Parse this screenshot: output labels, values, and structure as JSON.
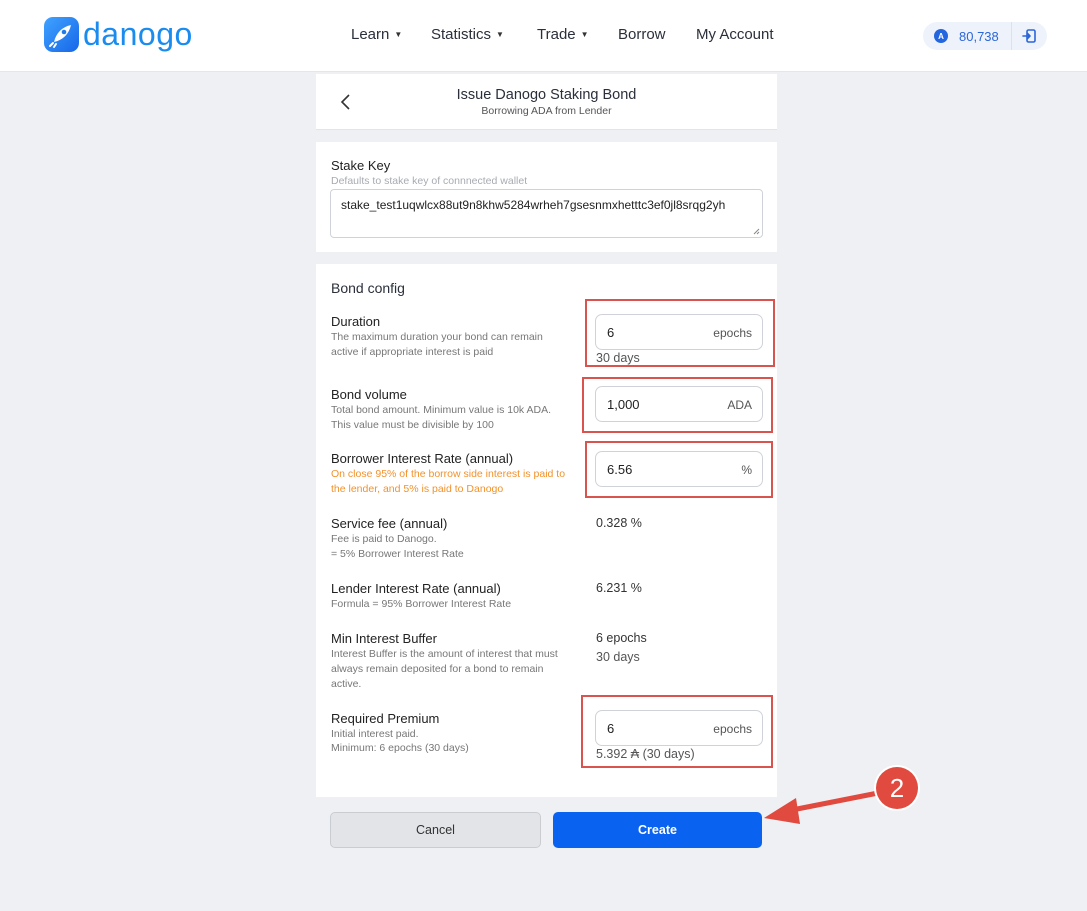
{
  "header": {
    "logo_text": "danogo",
    "nav": [
      {
        "label": "Learn",
        "has_caret": true
      },
      {
        "label": "Statistics",
        "has_caret": true
      },
      {
        "label": "Trade",
        "has_caret": true
      },
      {
        "label": "Borrow",
        "has_caret": false
      },
      {
        "label": "My Account",
        "has_caret": false
      }
    ],
    "balance": "80,738",
    "balance_badge": "A"
  },
  "page": {
    "title": "Issue Danogo Staking Bond",
    "subtitle": "Borrowing ADA from Lender"
  },
  "stake": {
    "label": "Stake Key",
    "hint": "Defaults to stake key of connnected wallet",
    "value": "stake_test1uqwlcx88ut9n8khw5284wrheh7gsesnmxhetttc3ef0jl8srqg2yh"
  },
  "config": {
    "section_title": "Bond config",
    "duration": {
      "label": "Duration",
      "hint": "The maximum duration your bond can remain active if appropriate interest is paid",
      "value": "6",
      "unit": "epochs",
      "below": "30 days"
    },
    "volume": {
      "label": "Bond volume",
      "hint1": "Total bond amount. Minimum value is 10k ADA.",
      "hint2": "This value must be divisible by 100",
      "value": "1,000",
      "unit": "ADA"
    },
    "borrower_rate": {
      "label": "Borrower Interest Rate (annual)",
      "hint": "On close 95% of the borrow side interest is paid to the lender, and 5% is paid to Danogo",
      "value": "6.56",
      "unit": "%"
    },
    "service_fee": {
      "label": "Service fee (annual)",
      "hint1": "Fee is paid to Danogo.",
      "hint2": "= 5% Borrower Interest Rate",
      "value": "0.328 %"
    },
    "lender_rate": {
      "label": "Lender Interest Rate (annual)",
      "hint": "Formula = 95% Borrower Interest Rate",
      "value": "6.231 %"
    },
    "min_buffer": {
      "label": "Min Interest Buffer",
      "hint": "Interest Buffer is the amount of interest that must always remain deposited for a bond to remain active.",
      "value1": "6 epochs",
      "value2": "30 days"
    },
    "premium": {
      "label": "Required Premium",
      "hint1": "Initial interest paid.",
      "hint2": "Minimum: 6 epochs (30 days)",
      "value": "6",
      "unit": "epochs",
      "below": "5.392 ₳ (30 days)"
    }
  },
  "actions": {
    "cancel": "Cancel",
    "create": "Create"
  },
  "annotation": {
    "step": "2",
    "color": "#e04a3f"
  }
}
